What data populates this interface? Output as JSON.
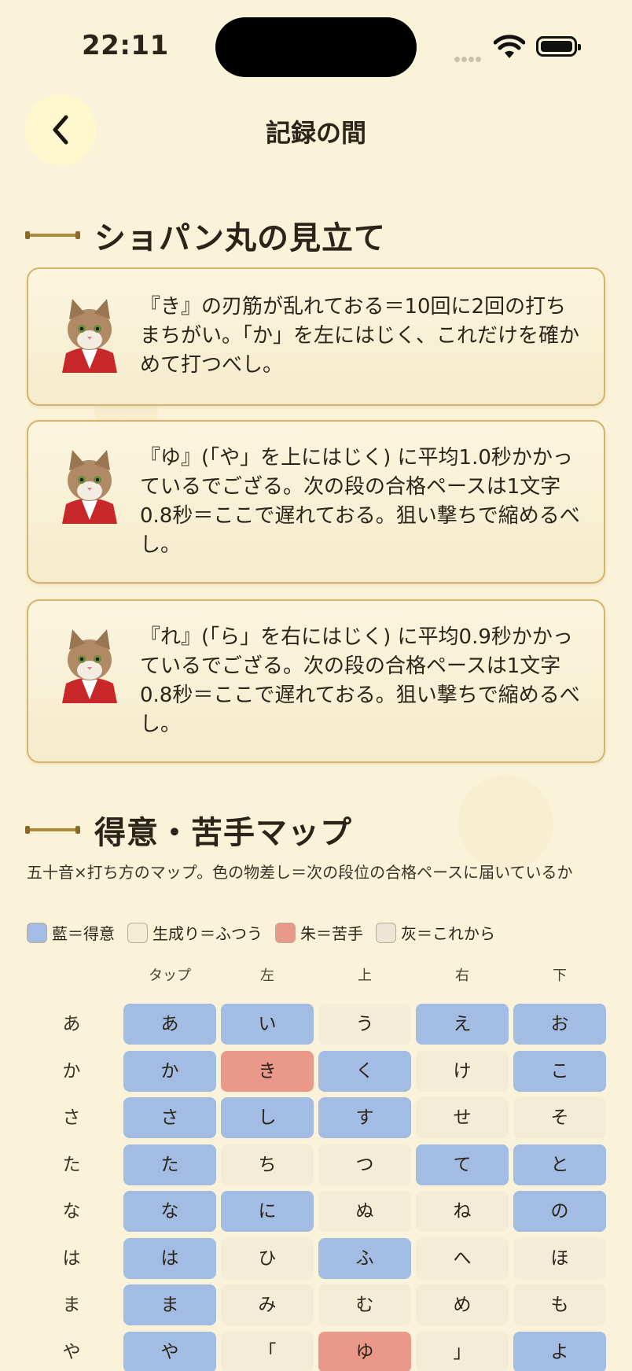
{
  "status": {
    "time": "22:11"
  },
  "nav": {
    "title": "記録の間"
  },
  "advice": {
    "title": "ショパン丸の見立て",
    "cards": [
      {
        "text": "『き』の刃筋が乱れておる＝10回に2回の打ちまちがい。「か」を左にはじく、これだけを確かめて打つべし。"
      },
      {
        "text": "『ゆ』(「や」を上にはじく) に平均1.0秒かかっているでござる。次の段の合格ペースは1文字0.8秒＝ここで遅れておる。狙い撃ちで縮めるべし。"
      },
      {
        "text": "『れ』(「ら」を右にはじく) に平均0.9秒かかっているでござる。次の段の合格ペースは1文字0.8秒＝ここで遅れておる。狙い撃ちで縮めるべし。"
      }
    ]
  },
  "map": {
    "title": "得意・苦手マップ",
    "description": "五十音×打ち方のマップ。色の物差し＝次の段位の合格ペースに届いているか",
    "legend": [
      {
        "label": "藍＝得意",
        "color": "#a3bce4"
      },
      {
        "label": "生成り＝ふつう",
        "color": "#f4ecd6"
      },
      {
        "label": "朱＝苦手",
        "color": "#e9988a"
      },
      {
        "label": "灰＝これから",
        "color": "#ece5d3"
      }
    ],
    "columns": [
      "タップ",
      "左",
      "上",
      "右",
      "下"
    ],
    "rows": [
      {
        "label": "あ",
        "cells": [
          [
            "あ",
            "good"
          ],
          [
            "い",
            "good"
          ],
          [
            "う",
            "normal"
          ],
          [
            "え",
            "good"
          ],
          [
            "お",
            "good"
          ]
        ]
      },
      {
        "label": "か",
        "cells": [
          [
            "か",
            "good"
          ],
          [
            "き",
            "weak"
          ],
          [
            "く",
            "good"
          ],
          [
            "け",
            "normal"
          ],
          [
            "こ",
            "good"
          ]
        ]
      },
      {
        "label": "さ",
        "cells": [
          [
            "さ",
            "good"
          ],
          [
            "し",
            "good"
          ],
          [
            "す",
            "good"
          ],
          [
            "せ",
            "normal"
          ],
          [
            "そ",
            "normal"
          ]
        ]
      },
      {
        "label": "た",
        "cells": [
          [
            "た",
            "good"
          ],
          [
            "ち",
            "normal"
          ],
          [
            "つ",
            "normal"
          ],
          [
            "て",
            "good"
          ],
          [
            "と",
            "good"
          ]
        ]
      },
      {
        "label": "な",
        "cells": [
          [
            "な",
            "good"
          ],
          [
            "に",
            "good"
          ],
          [
            "ぬ",
            "normal"
          ],
          [
            "ね",
            "normal"
          ],
          [
            "の",
            "good"
          ]
        ]
      },
      {
        "label": "は",
        "cells": [
          [
            "は",
            "good"
          ],
          [
            "ひ",
            "normal"
          ],
          [
            "ふ",
            "good"
          ],
          [
            "へ",
            "normal"
          ],
          [
            "ほ",
            "normal"
          ]
        ]
      },
      {
        "label": "ま",
        "cells": [
          [
            "ま",
            "good"
          ],
          [
            "み",
            "normal"
          ],
          [
            "む",
            "normal"
          ],
          [
            "め",
            "normal"
          ],
          [
            "も",
            "normal"
          ]
        ]
      },
      {
        "label": "や",
        "cells": [
          [
            "や",
            "good"
          ],
          [
            "「",
            "normal"
          ],
          [
            "ゆ",
            "weak"
          ],
          [
            "」",
            "normal"
          ],
          [
            "よ",
            "good"
          ]
        ]
      }
    ]
  }
}
